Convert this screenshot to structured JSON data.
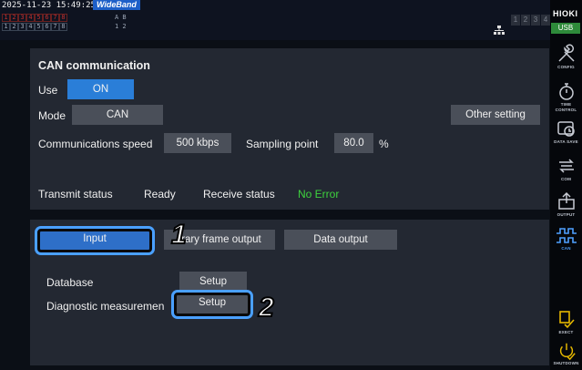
{
  "status_bar": {
    "timestamp": "2025-11-23 15:49:25",
    "mode_badge": "WideBand",
    "channel_row1": [
      "1",
      "2",
      "3",
      "4",
      "5",
      "6",
      "7",
      "8"
    ],
    "channel_row2": [
      "1",
      "2",
      "3",
      "4",
      "5",
      "6",
      "7",
      "8"
    ],
    "ab_labels": "A B",
    "ab_labels2": "1 2",
    "slots": [
      "1",
      "2",
      "3",
      "4"
    ]
  },
  "sidebar": {
    "brand": "HIOKI",
    "usb": "USB",
    "items": [
      {
        "label": "CONFIG",
        "icon": "wrench-icon"
      },
      {
        "label": "TIME CONTROL",
        "icon": "stopwatch-icon"
      },
      {
        "label": "DATA SAVE",
        "icon": "data-save-icon"
      },
      {
        "label": "COM",
        "icon": "com-icon"
      },
      {
        "label": "OUTPUT",
        "icon": "output-icon"
      },
      {
        "label": "CAN",
        "icon": "can-icon"
      },
      {
        "label": "EXECT",
        "icon": "execute-icon"
      },
      {
        "label": "SHUTDOWN",
        "icon": "shutdown-icon"
      }
    ],
    "active_item": "CAN"
  },
  "can_panel": {
    "title": "CAN communication",
    "use_label": "Use",
    "use_value": "ON",
    "mode_label": "Mode",
    "mode_value": "CAN",
    "other_setting": "Other setting",
    "speed_label": "Communications speed",
    "speed_value": "500 kbps",
    "sampling_label": "Sampling point",
    "sampling_value": "80.0",
    "sampling_unit": "%",
    "transmit_label": "Transmit status",
    "transmit_value": "Ready",
    "receive_label": "Receive status",
    "receive_value": "No Error"
  },
  "io_panel": {
    "tabs": [
      "Input",
      "rrary frame output",
      "Data output"
    ],
    "database_label": "Database",
    "database_button": "Setup",
    "diag_label": "Diagnostic measuremen",
    "diag_button": "Setup"
  },
  "callouts": [
    "1",
    "2"
  ],
  "colors": {
    "accent_blue": "#2a7ed8",
    "highlight_ring": "#4aa0ff",
    "status_ok": "#3ed23e",
    "panel_bg": "#232832"
  }
}
